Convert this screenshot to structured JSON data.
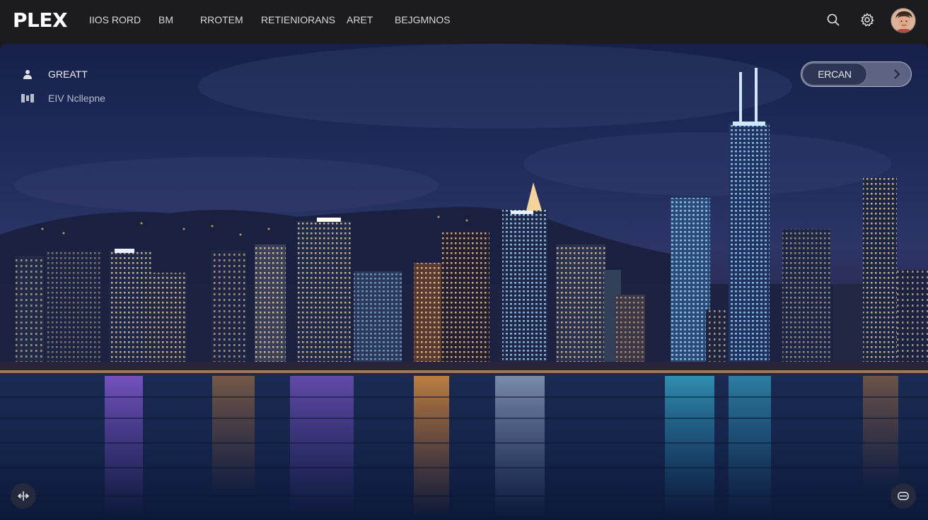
{
  "app": {
    "logo": "PLEX"
  },
  "nav": {
    "items": [
      {
        "label": "IIOS RORD"
      },
      {
        "label": "BM"
      },
      {
        "label": "RROTEM"
      },
      {
        "label": "RETIENIORANS"
      },
      {
        "label": "ARET"
      },
      {
        "label": "BEJGMNOS"
      }
    ]
  },
  "header_icons": [
    "search-icon",
    "gear-icon",
    "avatar"
  ],
  "hero": {
    "status_primary": "GREATT",
    "status_secondary": "EIV Ncllepne",
    "pill_label": "ERCAN",
    "icons": [
      "head-icon",
      "film-icon",
      "chevron-right-icon",
      "move-icon",
      "menu-icon"
    ]
  },
  "colors": {
    "topbar": "#1c1b20",
    "sky": "#1e2a52",
    "water": "#0e1a36",
    "pill_active": "#2c3552"
  }
}
